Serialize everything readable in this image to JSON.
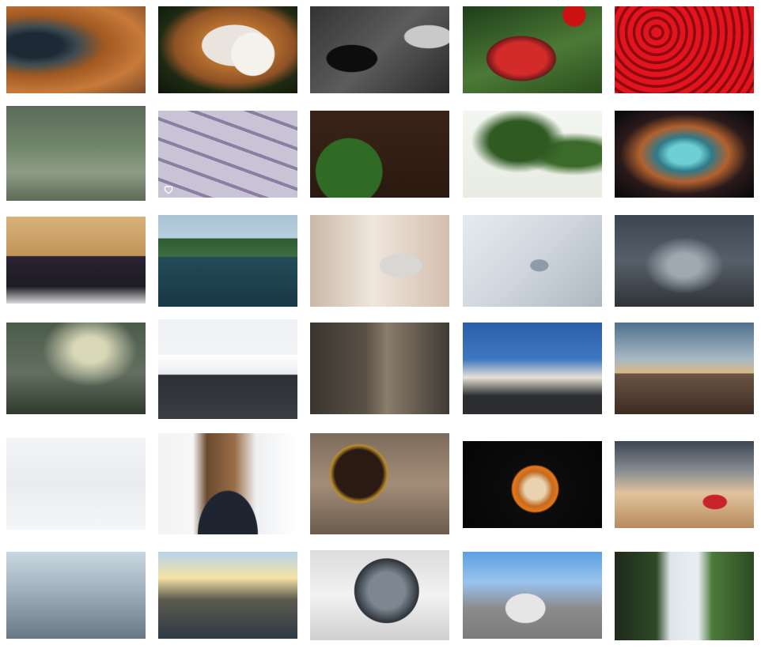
{
  "gallery": {
    "items": [
      {
        "name": "photo-fur-closeup",
        "style": "p-fur"
      },
      {
        "name": "photo-dog",
        "style": "p-dog"
      },
      {
        "name": "photo-metal-tools",
        "style": "p-tools"
      },
      {
        "name": "photo-red-drink",
        "style": "p-drink"
      },
      {
        "name": "photo-cherries",
        "style": "p-cherry"
      },
      {
        "name": "photo-rainy-window",
        "style": "p-rain"
      },
      {
        "name": "photo-pills",
        "style": "p-pills",
        "favorite_icon": "heart-outline-icon"
      },
      {
        "name": "photo-green-leaves-capsules",
        "style": "p-leaf"
      },
      {
        "name": "photo-tree-branches",
        "style": "p-tree"
      },
      {
        "name": "photo-crab-nebula",
        "style": "p-nebula"
      },
      {
        "name": "photo-poker-chips",
        "style": "p-chips"
      },
      {
        "name": "photo-mountain-lake",
        "style": "p-lake"
      },
      {
        "name": "photo-robot-pizza",
        "style": "p-robot"
      },
      {
        "name": "photo-white-machine",
        "style": "p-machine"
      },
      {
        "name": "photo-foggy-forest",
        "style": "p-forest"
      },
      {
        "name": "photo-misty-railway",
        "style": "p-rail"
      },
      {
        "name": "photo-snowy-road",
        "style": "p-snowroad"
      },
      {
        "name": "photo-canyon-walkway",
        "style": "p-canyon"
      },
      {
        "name": "photo-wind-turbines-road",
        "style": "p-wind"
      },
      {
        "name": "photo-sea-pier",
        "style": "p-pier"
      },
      {
        "name": "photo-snow-field",
        "style": "p-snow"
      },
      {
        "name": "photo-feet-on-log",
        "style": "p-tracks"
      },
      {
        "name": "photo-coffee-beans",
        "style": "p-coffee"
      },
      {
        "name": "photo-latte-art",
        "style": "p-latte"
      },
      {
        "name": "photo-beach-boat",
        "style": "p-boat"
      },
      {
        "name": "photo-ruined-city",
        "style": "p-ruins"
      },
      {
        "name": "photo-city-skyline",
        "style": "p-city"
      },
      {
        "name": "photo-astronaut",
        "style": "p-astro"
      },
      {
        "name": "photo-vw-van",
        "style": "p-van"
      },
      {
        "name": "photo-waterfall",
        "style": "p-waterfall"
      }
    ]
  }
}
